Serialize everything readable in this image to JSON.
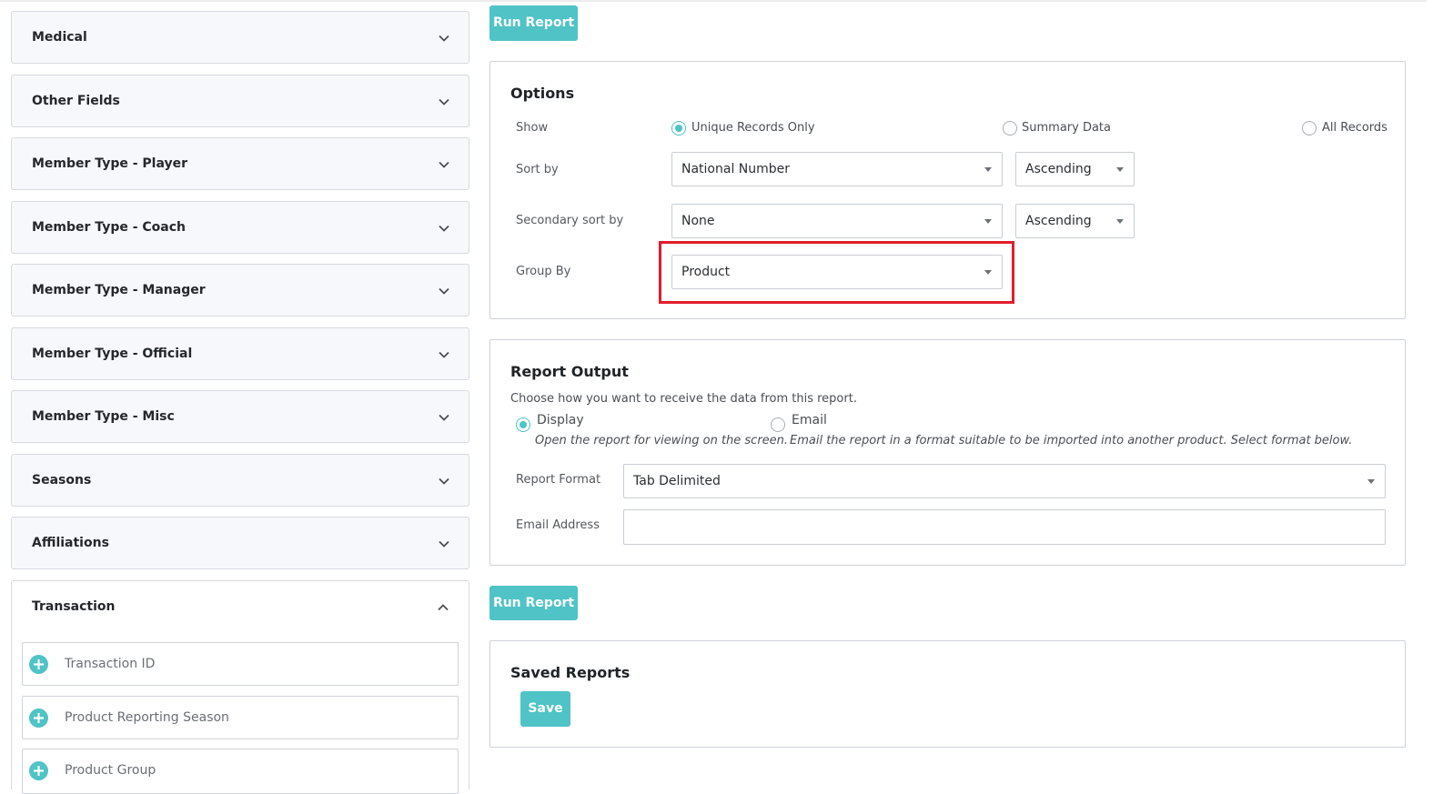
{
  "sidebar": {
    "sections": [
      {
        "label": "Medical"
      },
      {
        "label": "Other Fields"
      },
      {
        "label": "Member Type - Player"
      },
      {
        "label": "Member Type - Coach"
      },
      {
        "label": "Member Type - Manager"
      },
      {
        "label": "Member Type - Official"
      },
      {
        "label": "Member Type - Misc"
      },
      {
        "label": "Seasons"
      },
      {
        "label": "Affiliations"
      }
    ],
    "open_section": {
      "label": "Transaction",
      "fields": [
        {
          "label": "Transaction ID"
        },
        {
          "label": "Product Reporting Season"
        },
        {
          "label": "Product Group"
        }
      ]
    }
  },
  "actions": {
    "run_report_top": "Run Report",
    "run_report_bottom": "Run Report"
  },
  "options": {
    "title": "Options",
    "show_label": "Show",
    "show_options": [
      {
        "label": "Unique Records Only",
        "selected": true
      },
      {
        "label": "Summary Data",
        "selected": false
      },
      {
        "label": "All Records",
        "selected": false
      }
    ],
    "sort_by_label": "Sort by",
    "sort_by_value": "National Number",
    "sort_by_order": "Ascending",
    "secondary_sort_label": "Secondary sort by",
    "secondary_sort_value": "None",
    "secondary_sort_order": "Ascending",
    "group_by_label": "Group By",
    "group_by_value": "Product"
  },
  "report_output": {
    "title": "Report Output",
    "intro": "Choose how you want to receive the data from this report.",
    "display_label": "Display",
    "display_desc": "Open the report for viewing on the screen.",
    "email_label": "Email",
    "email_desc": "Email the report in a format suitable to be imported into another product. Select format below.",
    "format_label": "Report Format",
    "format_value": "Tab Delimited",
    "email_address_label": "Email Address",
    "email_address_value": ""
  },
  "saved_reports": {
    "title": "Saved Reports",
    "save_label": "Save"
  },
  "colors": {
    "accent": "#4fc3c6",
    "highlight": "#e11d2a"
  }
}
